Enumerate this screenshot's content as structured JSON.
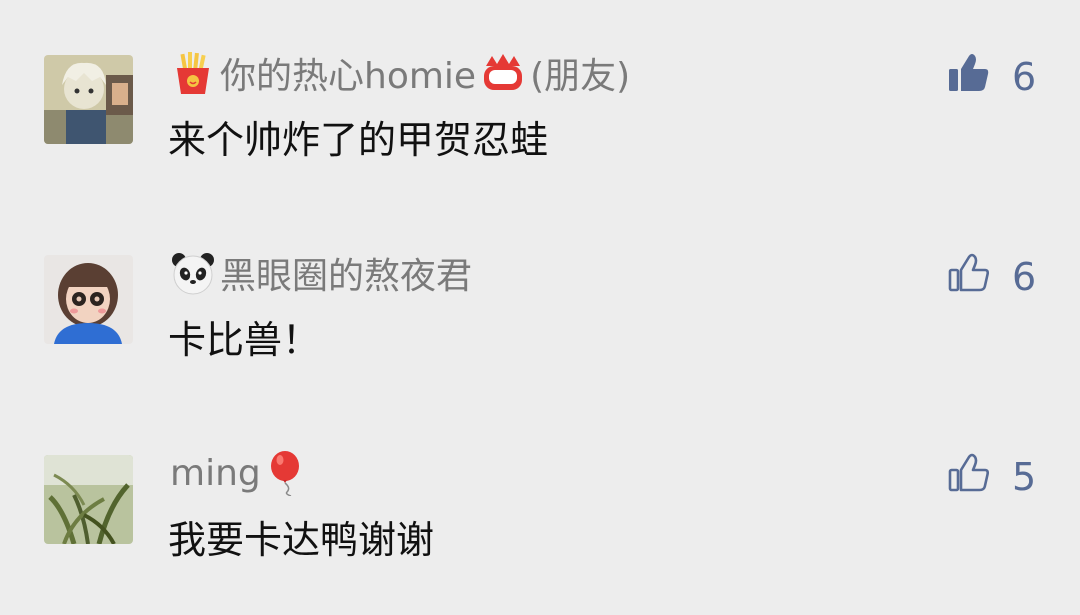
{
  "comments": [
    {
      "name": "你的热心homie",
      "name_suffix": "(朋友)",
      "lead_emoji": "fries-icon",
      "trail_emoji": "bathtub-icon",
      "text": "来个帅炸了的甲贺忍蛙",
      "likes": "6",
      "liked": true
    },
    {
      "name": "黑眼圈的熬夜君",
      "lead_emoji": "panda-icon",
      "text": "卡比兽！",
      "likes": "6",
      "liked": false
    },
    {
      "name": "ming",
      "trail_emoji": "balloon-icon",
      "text": "我要卡达鸭谢谢",
      "likes": "5",
      "liked": false
    }
  ],
  "colors": {
    "background": "#ededed",
    "name": "#7a7a7a",
    "text": "#111111",
    "like": "#576b95"
  }
}
